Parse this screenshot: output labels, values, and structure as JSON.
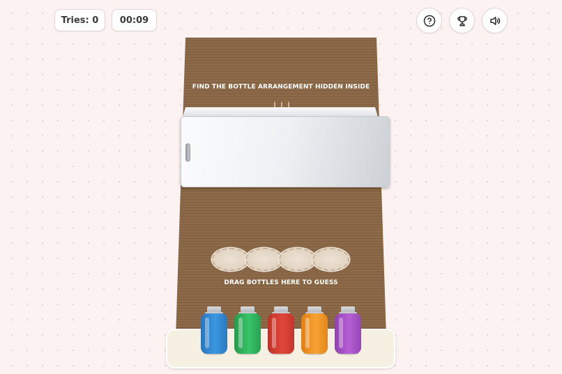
{
  "header": {
    "tries_label": "Tries: 0",
    "timer": "00:09",
    "help_icon": "question-circle-icon",
    "trophy_icon": "trophy-icon",
    "sound_icon": "speaker-icon"
  },
  "board": {
    "instruction_top": "FIND THE BOTTLE ARRANGEMENT HIDDEN INSIDE",
    "instruction_bottom": "DRAG BOTTLES HERE TO GUESS",
    "guess_slot_count": 4
  },
  "bottles": [
    {
      "color": "blue",
      "hex": "#2f86d0"
    },
    {
      "color": "green",
      "hex": "#2fb25a"
    },
    {
      "color": "red",
      "hex": "#d33b30"
    },
    {
      "color": "orange",
      "hex": "#f28f1c"
    },
    {
      "color": "purple",
      "hex": "#a24fc2"
    }
  ],
  "colors": {
    "background": "#fcf2f2",
    "board": "#8c6947",
    "tray": "#f6f0e2"
  }
}
